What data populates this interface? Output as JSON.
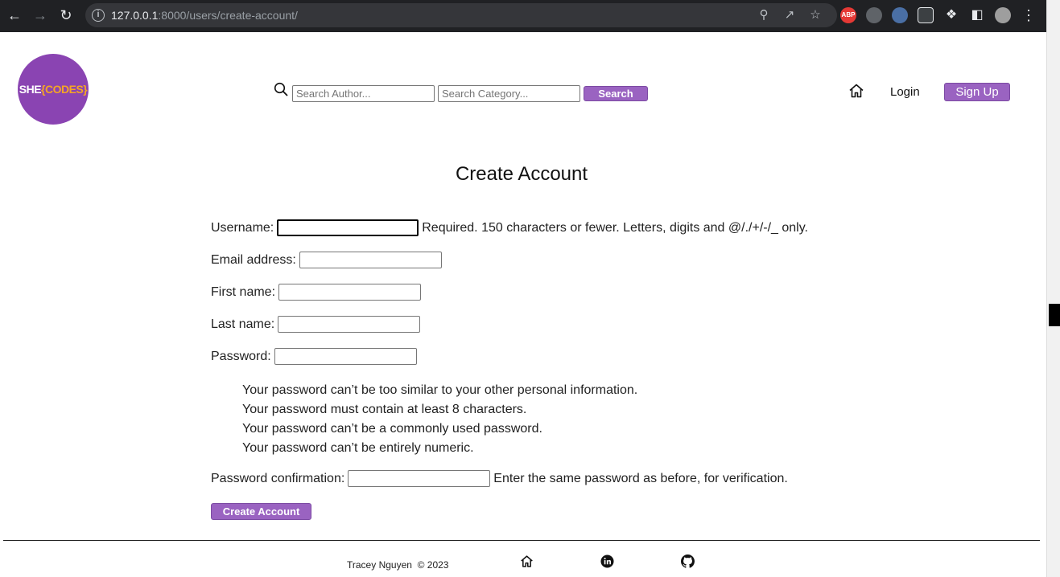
{
  "browser": {
    "url_host": "127.0.0.1",
    "url_rest": ":8000/users/create-account/",
    "extensions": [
      "ABP"
    ]
  },
  "header": {
    "logo_she": "SHE",
    "logo_codes": "{CODES}",
    "search_author_placeholder": "Search Author...",
    "search_category_placeholder": "Search Category...",
    "search_button": "Search",
    "login_link": "Login",
    "signup_button": "Sign Up"
  },
  "form": {
    "title": "Create Account",
    "username_label": "Username:",
    "username_help": "Required. 150 characters or fewer. Letters, digits and @/./+/-/_ only.",
    "email_label": "Email address:",
    "first_name_label": "First name:",
    "last_name_label": "Last name:",
    "password_label": "Password:",
    "password_help": [
      "Your password can’t be too similar to your other personal information.",
      "Your password must contain at least 8 characters.",
      "Your password can’t be a commonly used password.",
      "Your password can’t be entirely numeric."
    ],
    "password_confirmation_label": "Password confirmation:",
    "password_confirmation_help": "Enter the same password as before, for verification.",
    "submit_button": "Create Account"
  },
  "footer": {
    "copyright": "Tracey Nguyen  © 2023"
  },
  "colors": {
    "accent_purple": "#9a63c1",
    "logo_purple": "#8a44b2",
    "logo_orange": "#f5a623"
  }
}
